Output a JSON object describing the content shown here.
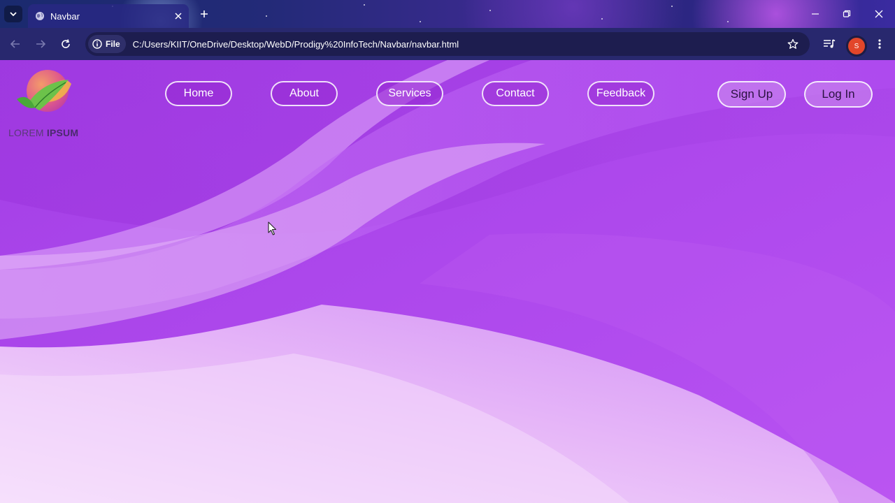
{
  "browser": {
    "tab_title": "Navbar",
    "site_info_label": "File",
    "url": "C:/Users/KIIT/OneDrive/Desktop/WebD/Prodigy%20InfoTech/Navbar/navbar.html",
    "profile_initial": "S"
  },
  "page": {
    "logo": {
      "word1": "LOREM",
      "word2": "IPSUM"
    },
    "nav": {
      "home": "Home",
      "about": "About",
      "services": "Services",
      "contact": "Contact",
      "feedback": "Feedback"
    },
    "auth": {
      "signup": "Sign Up",
      "login": "Log In"
    }
  },
  "colors": {
    "accent": "#b44ef0",
    "profile": "#e2462a"
  }
}
